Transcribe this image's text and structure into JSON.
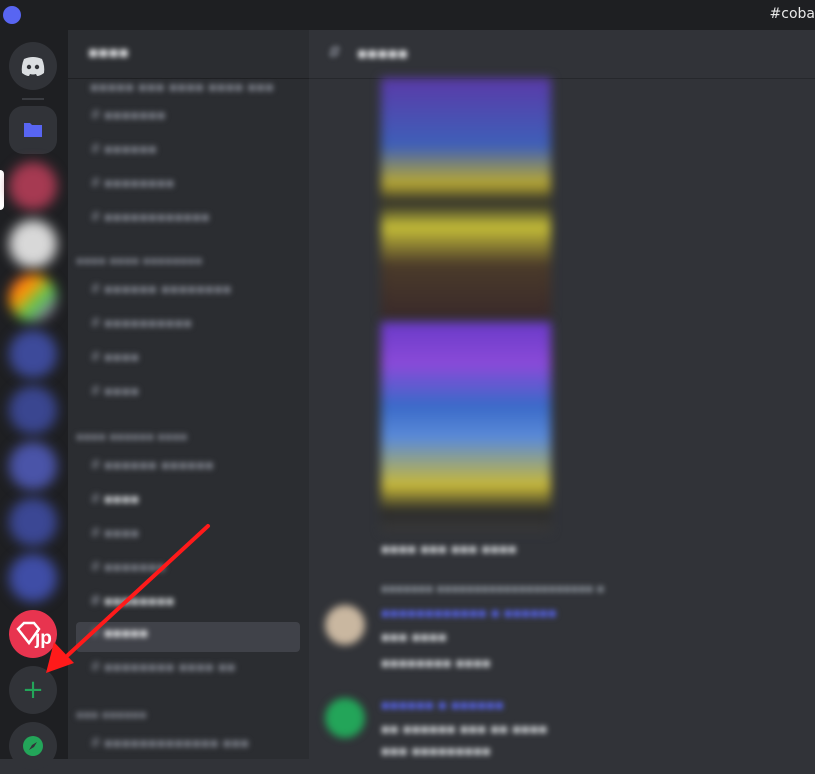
{
  "window": {
    "title": "#coba"
  },
  "sidebar": {
    "add_server_icon": "+",
    "explore_icon": "compass"
  },
  "colors": {
    "accent": "#5865f2",
    "green": "#23a559",
    "arrow": "#ff1a1a",
    "jp_red": "#e8344f"
  }
}
